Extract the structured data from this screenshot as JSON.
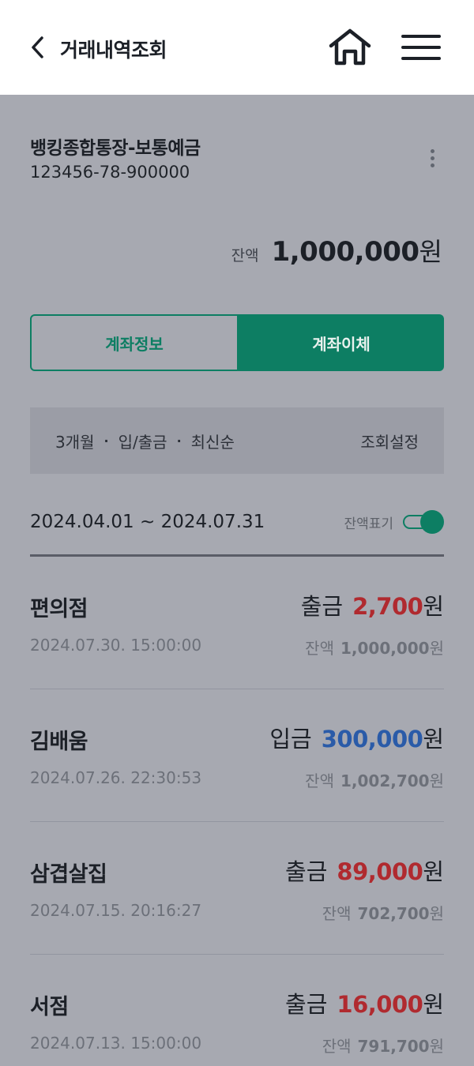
{
  "header": {
    "title": "거래내역조회"
  },
  "account": {
    "name": "뱅킹종합통장-보통예금",
    "number": "123456-78-900000",
    "balance_label": "잔액",
    "balance_amount": "1,000,000",
    "balance_unit": "원"
  },
  "actions": {
    "account_info_label": "계좌정보",
    "transfer_label": "계좌이체"
  },
  "filter": {
    "period": "3개월",
    "type": "입/출금",
    "order": "최신순",
    "separator": "·",
    "settings_label": "조회설정"
  },
  "date_range": {
    "text": "2024.04.01 ~ 2024.07.31",
    "toggle_label": "잔액표기",
    "toggle_on": true
  },
  "colors": {
    "accent": "#0d7e63",
    "withdrawal": "#b02a2f",
    "deposit": "#2a5ba8"
  },
  "transactions": [
    {
      "name": "편의점",
      "date": "2024.07.30. 15:00:00",
      "type_label": "출금",
      "kind": "out",
      "amount": "2,700",
      "unit": "원",
      "balance_label": "잔액",
      "balance": "1,000,000",
      "balance_unit": "원"
    },
    {
      "name": "김배움",
      "date": "2024.07.26. 22:30:53",
      "type_label": "입금",
      "kind": "in",
      "amount": "300,000",
      "unit": "원",
      "balance_label": "잔액",
      "balance": "1,002,700",
      "balance_unit": "원"
    },
    {
      "name": "삼겹살집",
      "date": "2024.07.15. 20:16:27",
      "type_label": "출금",
      "kind": "out",
      "amount": "89,000",
      "unit": "원",
      "balance_label": "잔액",
      "balance": "702,700",
      "balance_unit": "원"
    },
    {
      "name": "서점",
      "date": "2024.07.13. 15:00:00",
      "type_label": "출금",
      "kind": "out",
      "amount": "16,000",
      "unit": "원",
      "balance_label": "잔액",
      "balance": "791,700",
      "balance_unit": "원"
    }
  ]
}
